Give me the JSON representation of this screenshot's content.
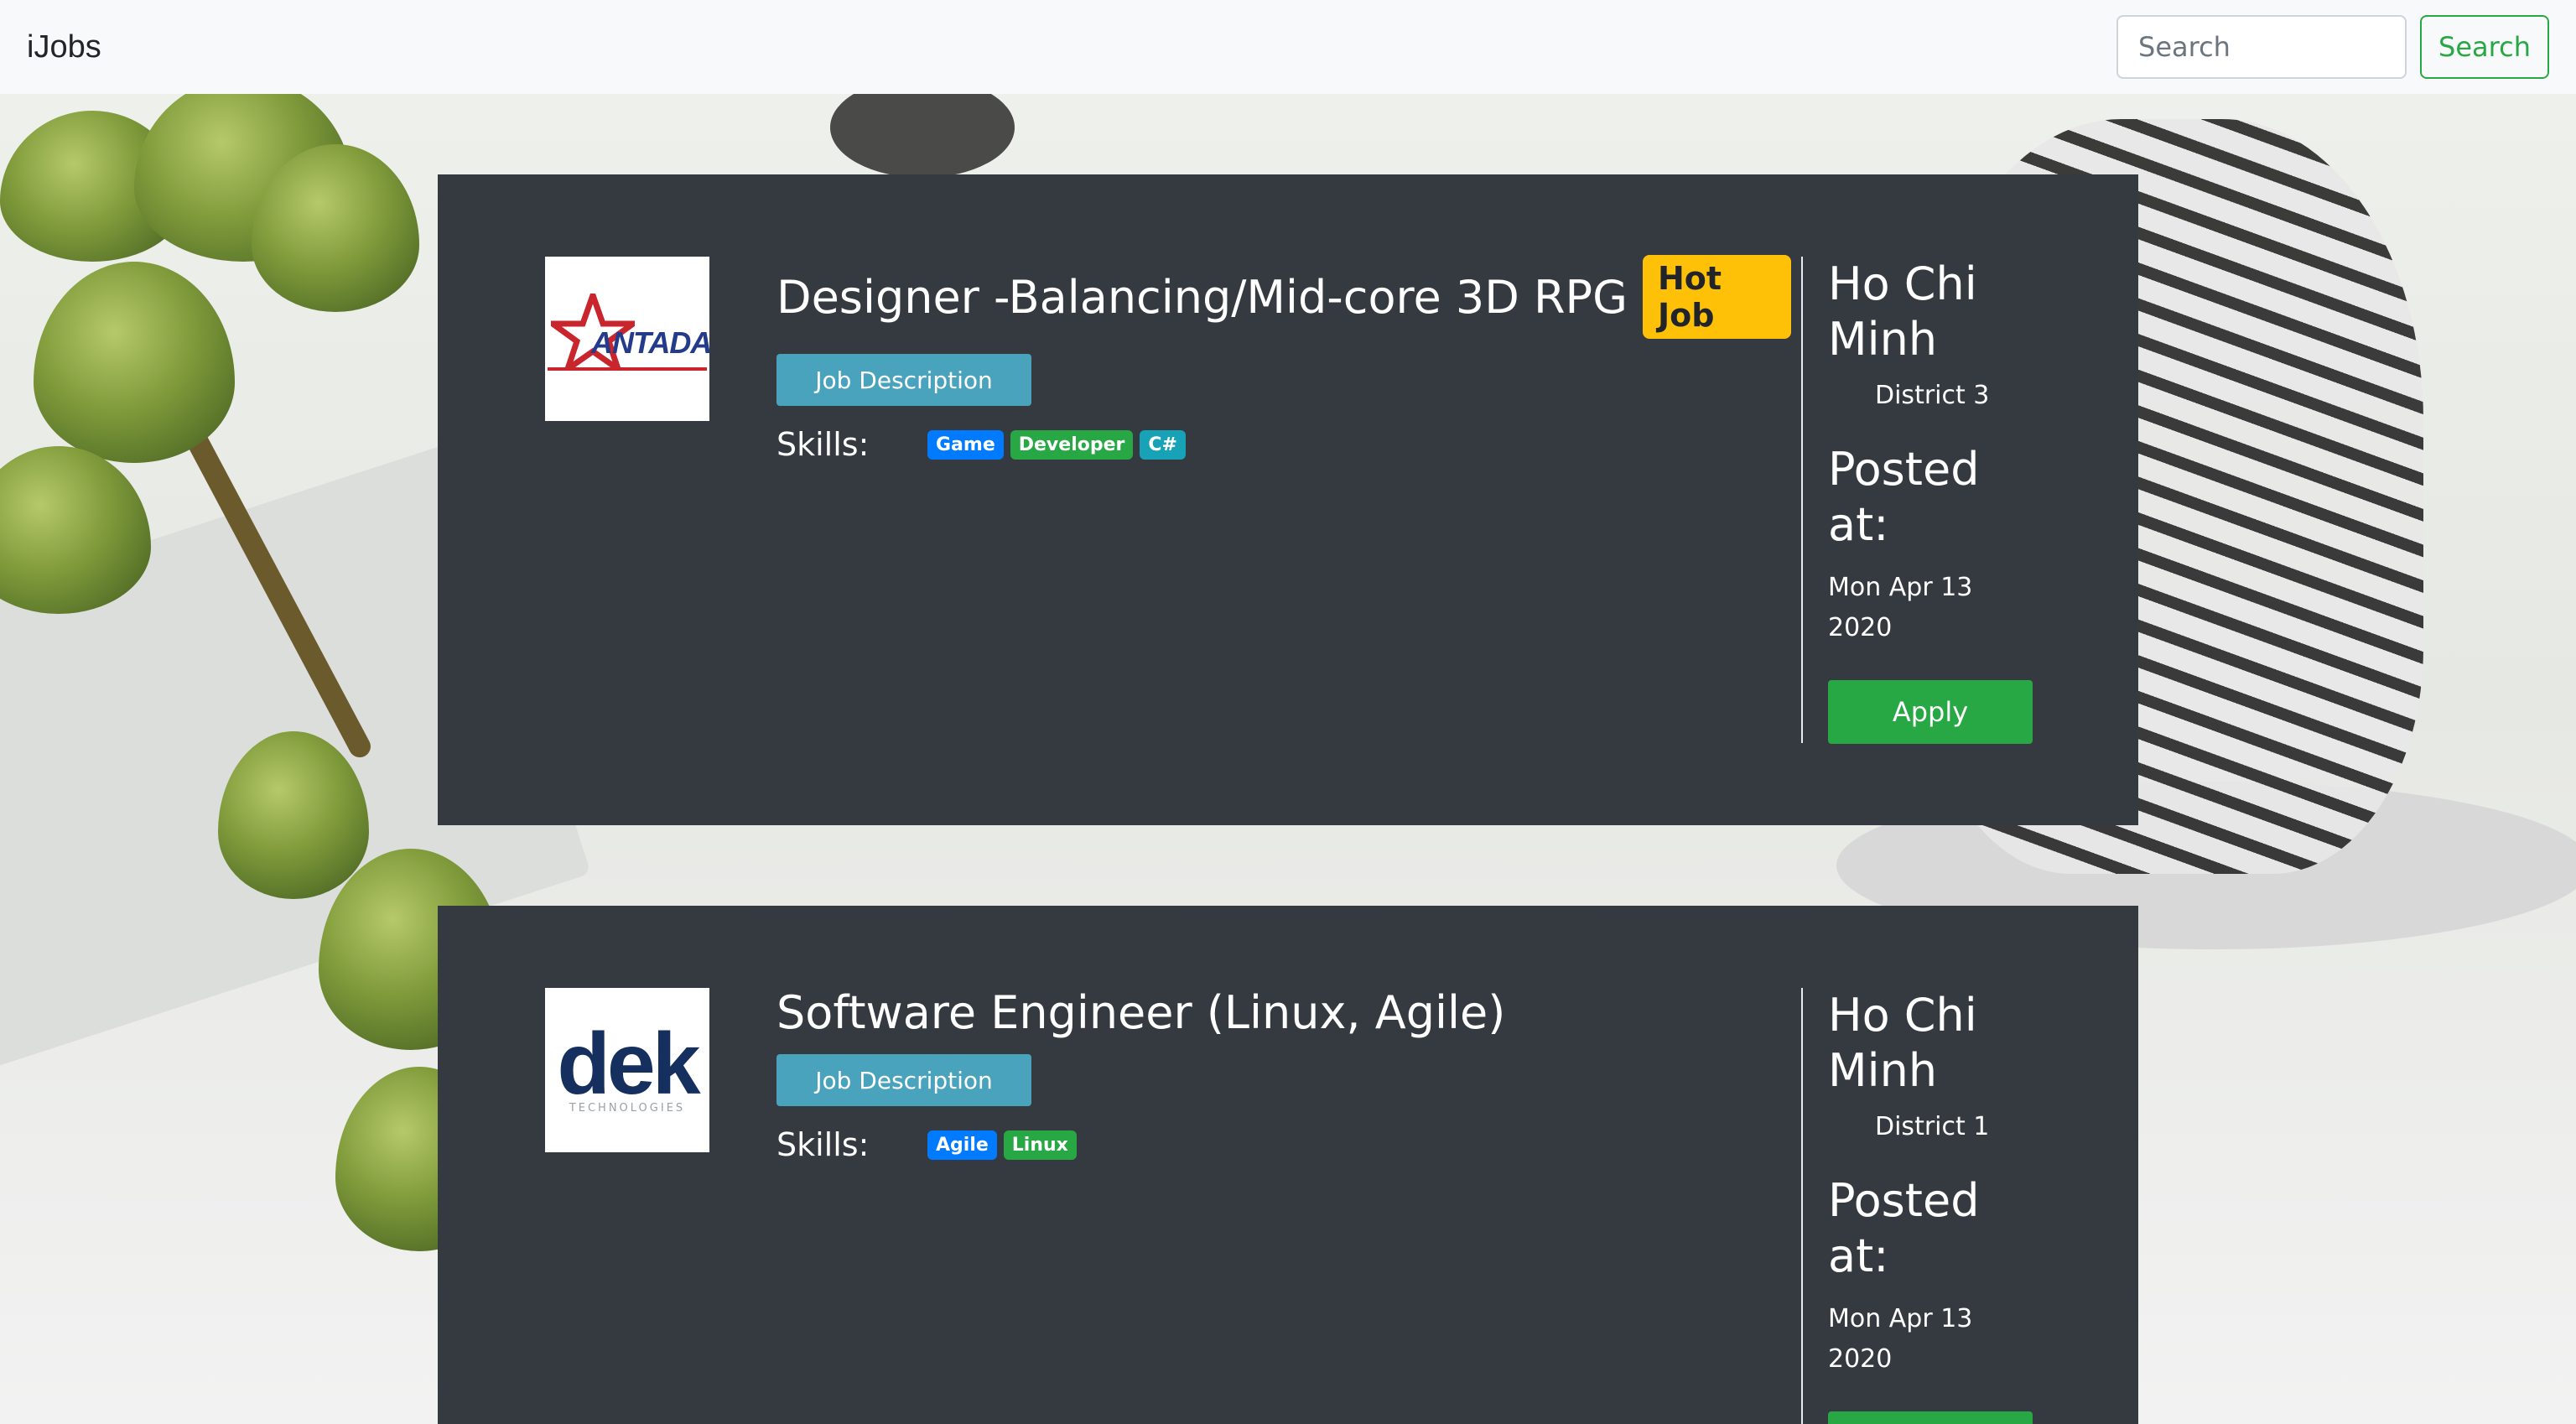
{
  "navbar": {
    "brand": "iJobs",
    "search_placeholder": "Search",
    "search_button": "Search"
  },
  "jobs": [
    {
      "company_logo": "antada-logo",
      "logo_text": "ANTADA",
      "title": "Designer -Balancing/Mid-core 3D RPG",
      "badge": "Hot Job",
      "description_button": "Job Description",
      "skills_label": "Skills:",
      "skills": [
        {
          "label": "Game",
          "color": "#007bff"
        },
        {
          "label": "Developer",
          "color": "#28a745"
        },
        {
          "label": "C#",
          "color": "#17a2b8"
        }
      ],
      "city": "Ho Chi Minh",
      "district": "District 3",
      "posted_label": "Posted at:",
      "posted_date": "Mon Apr 13 2020",
      "apply_button": "Apply"
    },
    {
      "company_logo": "dek-logo",
      "logo_text": "dek",
      "logo_subtext": "TECHNOLOGIES",
      "title": "Software Engineer (Linux, Agile)",
      "description_button": "Job Description",
      "skills_label": "Skills:",
      "skills": [
        {
          "label": "Agile",
          "color": "#007bff"
        },
        {
          "label": "Linux",
          "color": "#28a745"
        }
      ],
      "city": "Ho Chi Minh",
      "district": "District 1",
      "posted_label": "Posted at:",
      "posted_date": "Mon Apr 13 2020"
    }
  ],
  "colors": {
    "card_bg": "#343a40",
    "hot_badge": "#ffc107",
    "apply_green": "#28a745",
    "description_btn": "#4aa3bd"
  }
}
